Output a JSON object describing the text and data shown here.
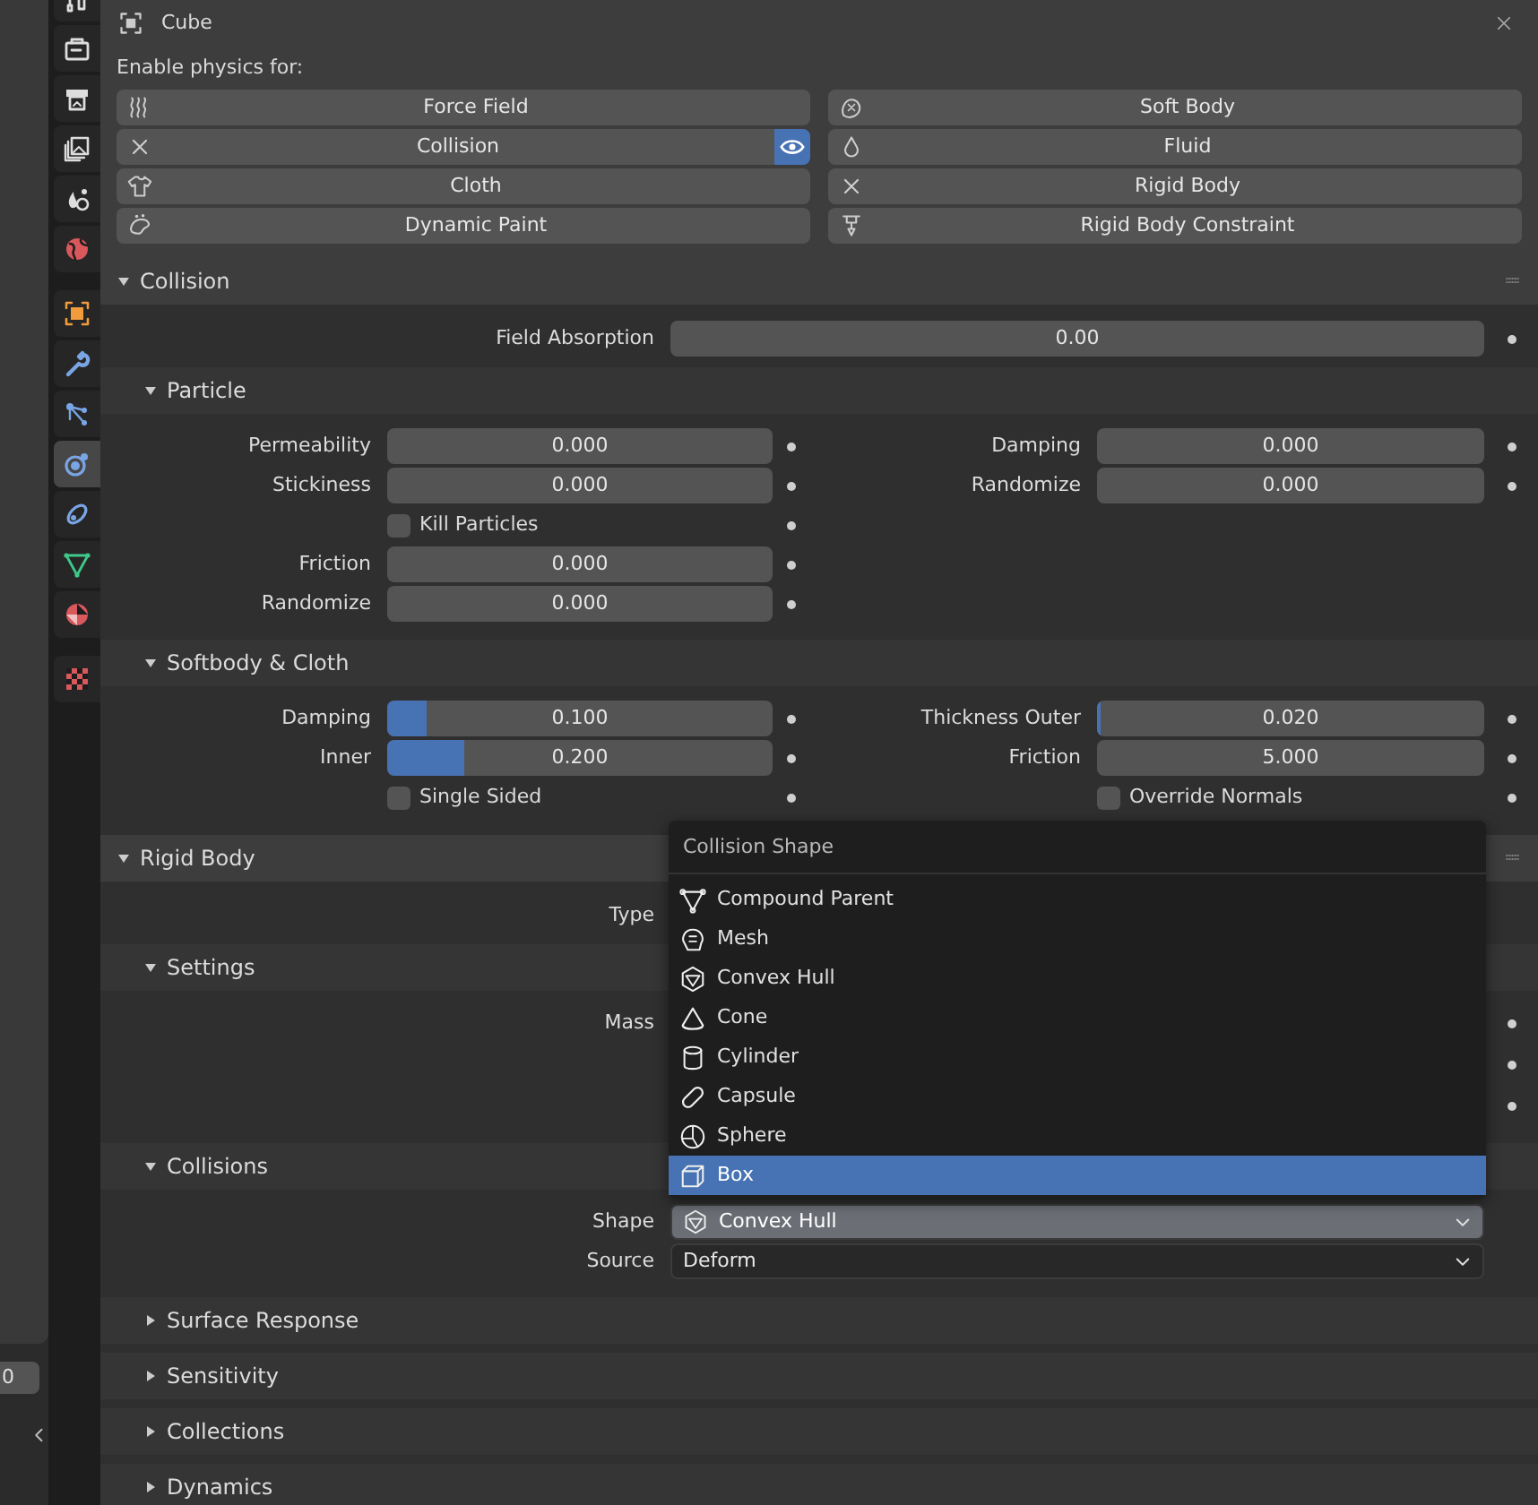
{
  "viewport": {
    "field_value": "0"
  },
  "property_tabs": [
    {
      "selected": false
    },
    {
      "selected": false
    },
    {
      "selected": false
    },
    {
      "selected": false
    },
    {
      "selected": false
    },
    {
      "selected": false
    },
    {
      "selected": false
    },
    {
      "selected": false
    },
    {
      "selected": false
    },
    {
      "selected": true
    },
    {
      "selected": false
    },
    {
      "selected": false
    },
    {
      "selected": false
    },
    {
      "selected": false
    }
  ],
  "object": {
    "name": "Cube"
  },
  "physics": {
    "heading": "Enable physics for:",
    "columns": [
      [
        {
          "label": "Force Field",
          "enabled": false,
          "show_in_viewport": false
        },
        {
          "label": "Collision",
          "enabled": true,
          "show_in_viewport": true
        },
        {
          "label": "Cloth",
          "enabled": false,
          "show_in_viewport": false
        },
        {
          "label": "Dynamic Paint",
          "enabled": false,
          "show_in_viewport": false
        }
      ],
      [
        {
          "label": "Soft Body",
          "enabled": false,
          "show_in_viewport": false
        },
        {
          "label": "Fluid",
          "enabled": false,
          "show_in_viewport": false
        },
        {
          "label": "Rigid Body",
          "enabled": true,
          "show_in_viewport": false
        },
        {
          "label": "Rigid Body Constraint",
          "enabled": false,
          "show_in_viewport": false
        }
      ]
    ]
  },
  "panels": [
    {
      "title": "Collision",
      "expanded": true,
      "rows": [
        {
          "full": {
            "kind": "number",
            "label": "Field Absorption",
            "value": "0.00"
          }
        }
      ],
      "subpanels": [
        {
          "title": "Particle",
          "expanded": true,
          "rows": [
            {
              "left": {
                "kind": "number",
                "label": "Permeability",
                "value": "0.000"
              },
              "right": {
                "kind": "number",
                "label": "Damping",
                "value": "0.000"
              }
            },
            {
              "left": {
                "kind": "number",
                "label": "Stickiness",
                "value": "0.000"
              },
              "right": {
                "kind": "number",
                "label": "Randomize",
                "value": "0.000"
              }
            },
            {
              "left": {
                "kind": "checkbox",
                "label": "Kill Particles",
                "checked": false
              }
            },
            {
              "left": {
                "kind": "number",
                "label": "Friction",
                "value": "0.000"
              }
            },
            {
              "left": {
                "kind": "number",
                "label": "Randomize",
                "value": "0.000"
              }
            }
          ]
        },
        {
          "title": "Softbody & Cloth",
          "expanded": true,
          "rows": [
            {
              "left": {
                "kind": "number",
                "label": "Damping",
                "value": "0.100",
                "level": 0.1
              },
              "right": {
                "kind": "number",
                "label": "Thickness Outer",
                "value": "0.020",
                "level": 0.01
              }
            },
            {
              "left": {
                "kind": "number",
                "label": "Inner",
                "value": "0.200",
                "level": 0.2
              },
              "right": {
                "kind": "number",
                "label": "Friction",
                "value": "5.000"
              }
            },
            {
              "left": {
                "kind": "checkbox",
                "label": "Single Sided",
                "checked": false
              },
              "right": {
                "kind": "checkbox",
                "label": "Override Normals",
                "checked": false
              }
            }
          ]
        }
      ]
    },
    {
      "title": "Rigid Body",
      "expanded": true,
      "rows": [
        {
          "full": {
            "kind": "dropdown",
            "label": "Type"
          }
        }
      ],
      "subpanels": [
        {
          "title": "Settings",
          "expanded": true,
          "rows": [
            {
              "full": {
                "kind": "covered",
                "label": "Mass"
              }
            },
            {
              "full": {
                "kind": "covered"
              }
            },
            {
              "full": {
                "kind": "covered"
              }
            }
          ]
        },
        {
          "title": "Collisions",
          "expanded": true,
          "rows": [
            {
              "full": {
                "kind": "dropdown",
                "label": "Shape",
                "value": "Convex Hull",
                "open": true,
                "menu": {
                  "title": "Collision Shape",
                  "items": [
                    {
                      "label": "Compound Parent",
                      "selected": false
                    },
                    {
                      "label": "Mesh",
                      "selected": false
                    },
                    {
                      "label": "Convex Hull",
                      "selected": false
                    },
                    {
                      "label": "Cone",
                      "selected": false
                    },
                    {
                      "label": "Cylinder",
                      "selected": false
                    },
                    {
                      "label": "Capsule",
                      "selected": false
                    },
                    {
                      "label": "Sphere",
                      "selected": false
                    },
                    {
                      "label": "Box",
                      "selected": true
                    }
                  ]
                }
              }
            },
            {
              "full": {
                "kind": "dropdown",
                "label": "Source",
                "value": "Deform",
                "open": false
              }
            }
          ]
        },
        {
          "title": "Surface Response",
          "expanded": false
        },
        {
          "title": "Sensitivity",
          "expanded": false
        },
        {
          "title": "Collections",
          "expanded": false
        },
        {
          "title": "Dynamics",
          "expanded": false
        }
      ]
    }
  ]
}
